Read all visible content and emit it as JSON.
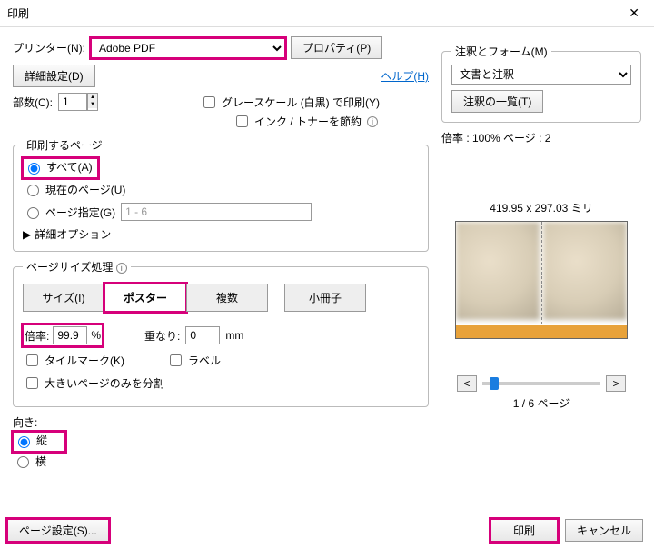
{
  "title": "印刷",
  "close_glyph": "✕",
  "help_link": "ヘルプ(H)",
  "printer": {
    "label": "プリンター(N):",
    "selected": "Adobe PDF",
    "properties_btn": "プロパティ(P)",
    "advanced_btn": "詳細設定(D)"
  },
  "copies": {
    "label": "部数(C):",
    "value": "1"
  },
  "options": {
    "grayscale": "グレースケール (白黒) で印刷(Y)",
    "save_ink": "インク / トナーを節約"
  },
  "pages": {
    "legend": "印刷するページ",
    "all": "すべて(A)",
    "current": "現在のページ(U)",
    "range_label": "ページ指定(G)",
    "range_value": "1 - 6",
    "advanced": "詳細オプション"
  },
  "sizing": {
    "legend": "ページサイズ処理",
    "tabs": {
      "size": "サイズ(I)",
      "poster": "ポスター",
      "multi": "複数",
      "booklet": "小冊子"
    },
    "scale_label": "倍率:",
    "scale_value": "99.9",
    "scale_unit": "%",
    "overlap_label": "重なり:",
    "overlap_value": "0",
    "overlap_unit": "mm",
    "tilemarks": "タイルマーク(K)",
    "labels": "ラベル",
    "large_only": "大きいページのみを分割"
  },
  "orientation": {
    "legend": "向き:",
    "portrait": "縦",
    "landscape": "横"
  },
  "right": {
    "legend": "注釈とフォーム(M)",
    "combo": "文書と注釈",
    "list_btn": "注釈の一覧(T)",
    "scale_info": "倍率 : 100% ページ : 2",
    "dims": "419.95 x 297.03 ミリ",
    "page_counter": "1 / 6 ページ"
  },
  "footer": {
    "page_setup": "ページ設定(S)...",
    "print": "印刷",
    "cancel": "キャンセル"
  }
}
